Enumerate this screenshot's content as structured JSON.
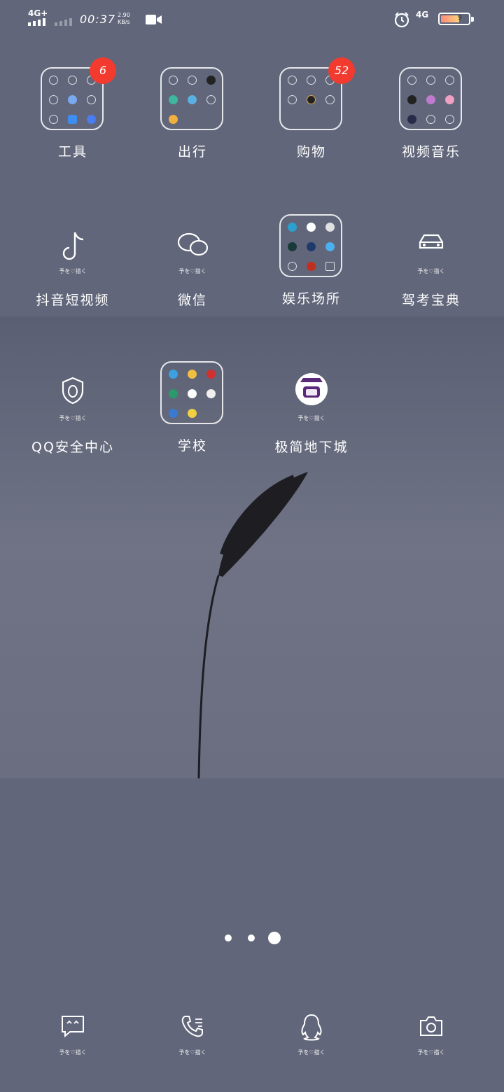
{
  "status_bar": {
    "network_left": "4G+",
    "time": "00:37",
    "speed_value": "2.90",
    "speed_unit": "KB/s",
    "network_right": "4G",
    "battery_level": "9"
  },
  "rows": [
    [
      {
        "type": "folder",
        "label": "工具",
        "badge": "6"
      },
      {
        "type": "folder",
        "label": "出行",
        "badge": null
      },
      {
        "type": "folder",
        "label": "购物",
        "badge": "52"
      },
      {
        "type": "folder",
        "label": "视频音乐",
        "badge": null
      }
    ],
    [
      {
        "type": "app",
        "label": "抖音短视频",
        "icon": "tiktok-note-icon",
        "sub": "予を♡描く"
      },
      {
        "type": "app",
        "label": "微信",
        "icon": "wechat-bubbles-icon",
        "sub": "予を♡描く"
      },
      {
        "type": "folder",
        "label": "娱乐场所",
        "badge": null
      },
      {
        "type": "app",
        "label": "驾考宝典",
        "icon": "car-icon",
        "sub": "予を♡描く"
      }
    ],
    [
      {
        "type": "app",
        "label": "QQ安全中心",
        "icon": "qq-shield-icon",
        "sub": "予を♡描く"
      },
      {
        "type": "folder",
        "label": "学校",
        "badge": null
      },
      {
        "type": "app",
        "label": "极简地下城",
        "icon": "dungeon-avatar-icon",
        "sub": "予を♡描く"
      }
    ]
  ],
  "pages": {
    "count": 3,
    "active_index": 2
  },
  "dock": [
    {
      "icon": "message-icon",
      "sub": "予を♡描く"
    },
    {
      "icon": "phone-icon",
      "sub": "予を♡描く"
    },
    {
      "icon": "qq-penguin-icon",
      "sub": "予を♡描く"
    },
    {
      "icon": "camera-icon",
      "sub": "予を♡描く"
    }
  ],
  "colors": {
    "background": "#61667a",
    "badge": "#f23a2f"
  }
}
